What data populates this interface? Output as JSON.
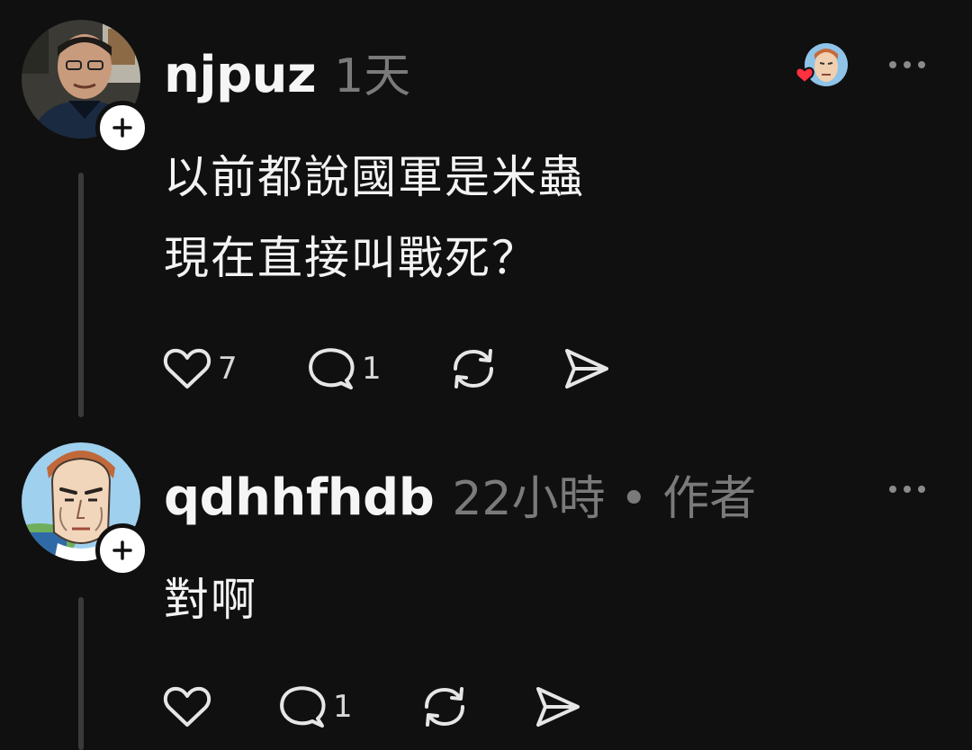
{
  "comments": [
    {
      "username": "njpuz",
      "time": "1天",
      "lines": [
        "以前都說國軍是米蟲",
        "現在直接叫戰死？"
      ],
      "likes": "7",
      "replies": "1"
    },
    {
      "username": "qdhhfhdb",
      "time": "22小時 • 作者",
      "lines": [
        "對啊"
      ],
      "likes": "",
      "replies": "1"
    }
  ],
  "colors": {
    "background": "#101010",
    "text": "#f3f3f3",
    "muted": "#7a7a7a",
    "thread_line": "#3a3a3a",
    "heart_red": "#ff3040"
  },
  "icons": [
    "follow-plus-icon",
    "heart-icon",
    "comment-icon",
    "repost-icon",
    "share-icon",
    "more-icon",
    "author-liked-badge"
  ]
}
